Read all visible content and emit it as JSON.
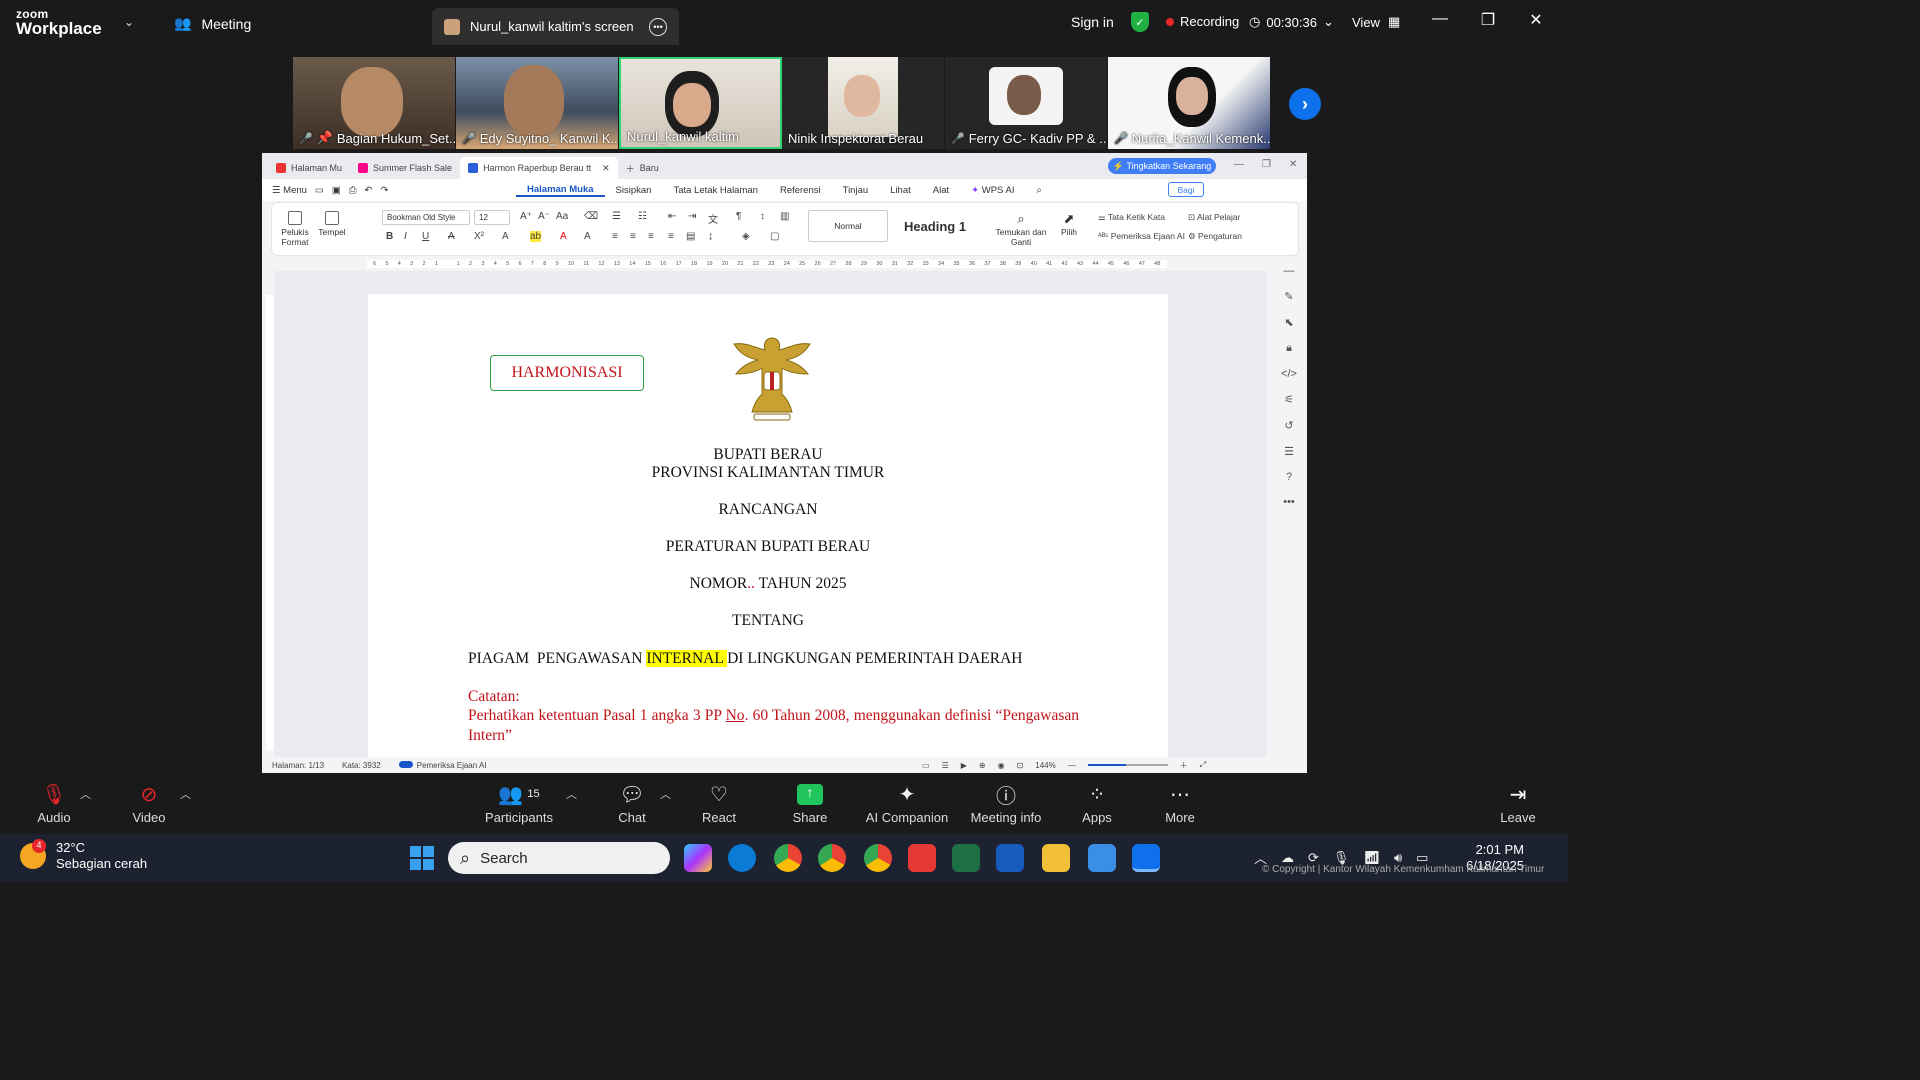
{
  "zoom": {
    "logo_line1": "zoom",
    "logo_line2": "Workplace",
    "meeting_label": "Meeting",
    "screen_tab_label": "Nurul_kanwil kaltim's screen",
    "sign_in": "Sign in",
    "recording_label": "Recording",
    "timer": "00:30:36",
    "view_label": "View",
    "accent_color": "#0e71eb",
    "recording_color": "#e8262a"
  },
  "participants": [
    {
      "name": "Bagian Hukum_Set...",
      "muted": true,
      "pinned": true
    },
    {
      "name": "Edy Suyitno_ Kanwil K...",
      "muted": true
    },
    {
      "name": "Nurul_kanwil kaltim",
      "muted": false,
      "active_speaker": true
    },
    {
      "name": "Ninik Inspektorat Berau",
      "muted": false
    },
    {
      "name": "Ferry GC- Kadiv PP & ...",
      "muted": true
    },
    {
      "name": "Nurita_Kanwil Kemenk...",
      "muted": true
    }
  ],
  "wps": {
    "tabs": [
      {
        "label": "Halaman Mu"
      },
      {
        "label": "Summer Flash Sale"
      },
      {
        "label": "Harmon Raperbup Berau tt"
      },
      {
        "label": "Baru"
      }
    ],
    "upgrade_button": "Tingkatkan Sekarang",
    "menu_label": "Menu",
    "menu_tabs": [
      "Halaman Muka",
      "Sisipkan",
      "Tata Letak Halaman",
      "Referensi",
      "Tinjau",
      "Lihat",
      "Alat",
      "WPS AI"
    ],
    "share_button": "Bagi",
    "ribbon": {
      "format_painter": "Pelukis Format",
      "paste": "Tempel",
      "font_name": "Bookman Old Style",
      "font_size": "12",
      "style_normal": "Normal",
      "style_heading": "Heading 1",
      "find_replace": "Temukan dan Ganti",
      "select": "Pilih",
      "typing_tool": "Tata Ketik Kata",
      "spellcheck_ai": "Pemeriksa Ejaan AI",
      "learning_tool": "Alat Pelajar",
      "settings": "Pengaturan"
    },
    "document": {
      "stamp": "HARMONISASI",
      "line1": "BUPATI BERAU",
      "line2": "PROVINSI KALIMANTAN TIMUR",
      "line3": "RANCANGAN",
      "line4": "PERATURAN BUPATI BERAU",
      "line5_a": "NOMOR",
      "line5_b": "..",
      "line5_c": " TAHUN 2025",
      "line6": "TENTANG",
      "title_a": "PIAGAM  PENGAWASAN ",
      "title_hl": "INTERNAL ",
      "title_b": "DI LINGKUNGAN PEMERINTAH DAERAH",
      "note_label": "Catatan:",
      "note_a": "Perhatikan ketentuan Pasal 1 angka 3 PP ",
      "note_no": "No",
      "note_b": ". 60 Tahun 2008, menggunakan definisi “Pengawasan Intern”",
      "highlight_color": "#ffff00",
      "note_color": "#c0141b"
    },
    "status": {
      "page": "Halaman: 1/13",
      "words": "Kata: 3932",
      "spellcheck": "Pemeriksa Ejaan AI",
      "zoom": "144%"
    },
    "ruler_ticks": [
      "6",
      "5",
      "4",
      "3",
      "2",
      "1",
      "",
      "1",
      "2",
      "3",
      "4",
      "5",
      "6",
      "7",
      "8",
      "9",
      "10",
      "11",
      "12",
      "13",
      "14",
      "15",
      "16",
      "17",
      "18",
      "19",
      "20",
      "21",
      "22",
      "23",
      "24",
      "25",
      "26",
      "27",
      "28",
      "29",
      "30",
      "31",
      "32",
      "33",
      "34",
      "35",
      "36",
      "37",
      "38",
      "39",
      "40",
      "41",
      "42",
      "43",
      "44",
      "45",
      "46",
      "47",
      "48"
    ]
  },
  "toolbar": {
    "audio": "Audio",
    "video": "Video",
    "participants": "Participants",
    "participant_count": "15",
    "chat": "Chat",
    "react": "React",
    "share": "Share",
    "ai_companion": "AI Companion",
    "meeting_info": "Meeting info",
    "apps": "Apps",
    "more": "More",
    "leave": "Leave"
  },
  "taskbar": {
    "temperature": "32°C",
    "weather": "Sebagian cerah",
    "weather_badge": "4",
    "search_label": "Search",
    "time": "2:01 PM",
    "date": "6/18/2025",
    "copyright": "© Copyright | Kantor Wilayah Kemenkumham Kalimantan Timur"
  }
}
